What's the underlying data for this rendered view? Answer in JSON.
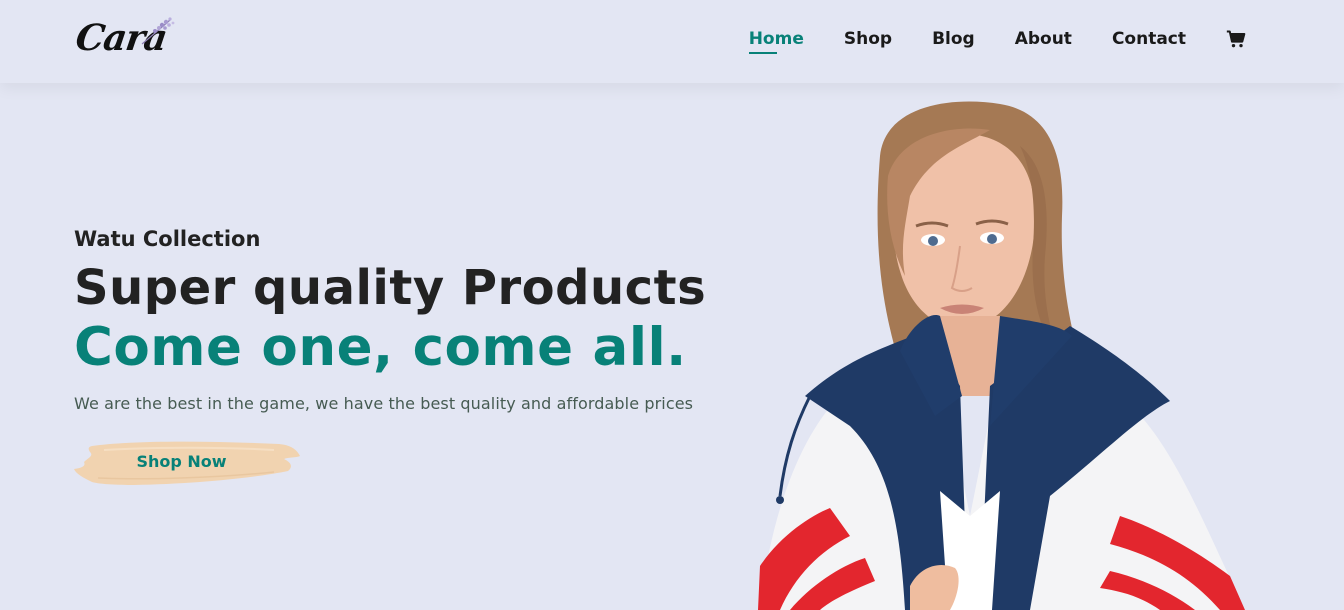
{
  "header": {
    "logo_text": "Cara",
    "nav": [
      {
        "label": "Home",
        "active": true
      },
      {
        "label": "Shop",
        "active": false
      },
      {
        "label": "Blog",
        "active": false
      },
      {
        "label": "About",
        "active": false
      },
      {
        "label": "Contact",
        "active": false
      }
    ],
    "cart_icon": "shopping-cart-icon"
  },
  "hero": {
    "kicker": "Watu Collection",
    "title": "Super quality Products",
    "title_accent": "Come one, come all.",
    "description": "We are the best in the game, we have the best quality and affordable prices",
    "button_label": "Shop Now"
  },
  "colors": {
    "background": "#e3e6f3",
    "accent": "#088178",
    "button_brush": "#f1d3b0",
    "text_dark": "#222222",
    "text_muted": "#465b52"
  }
}
